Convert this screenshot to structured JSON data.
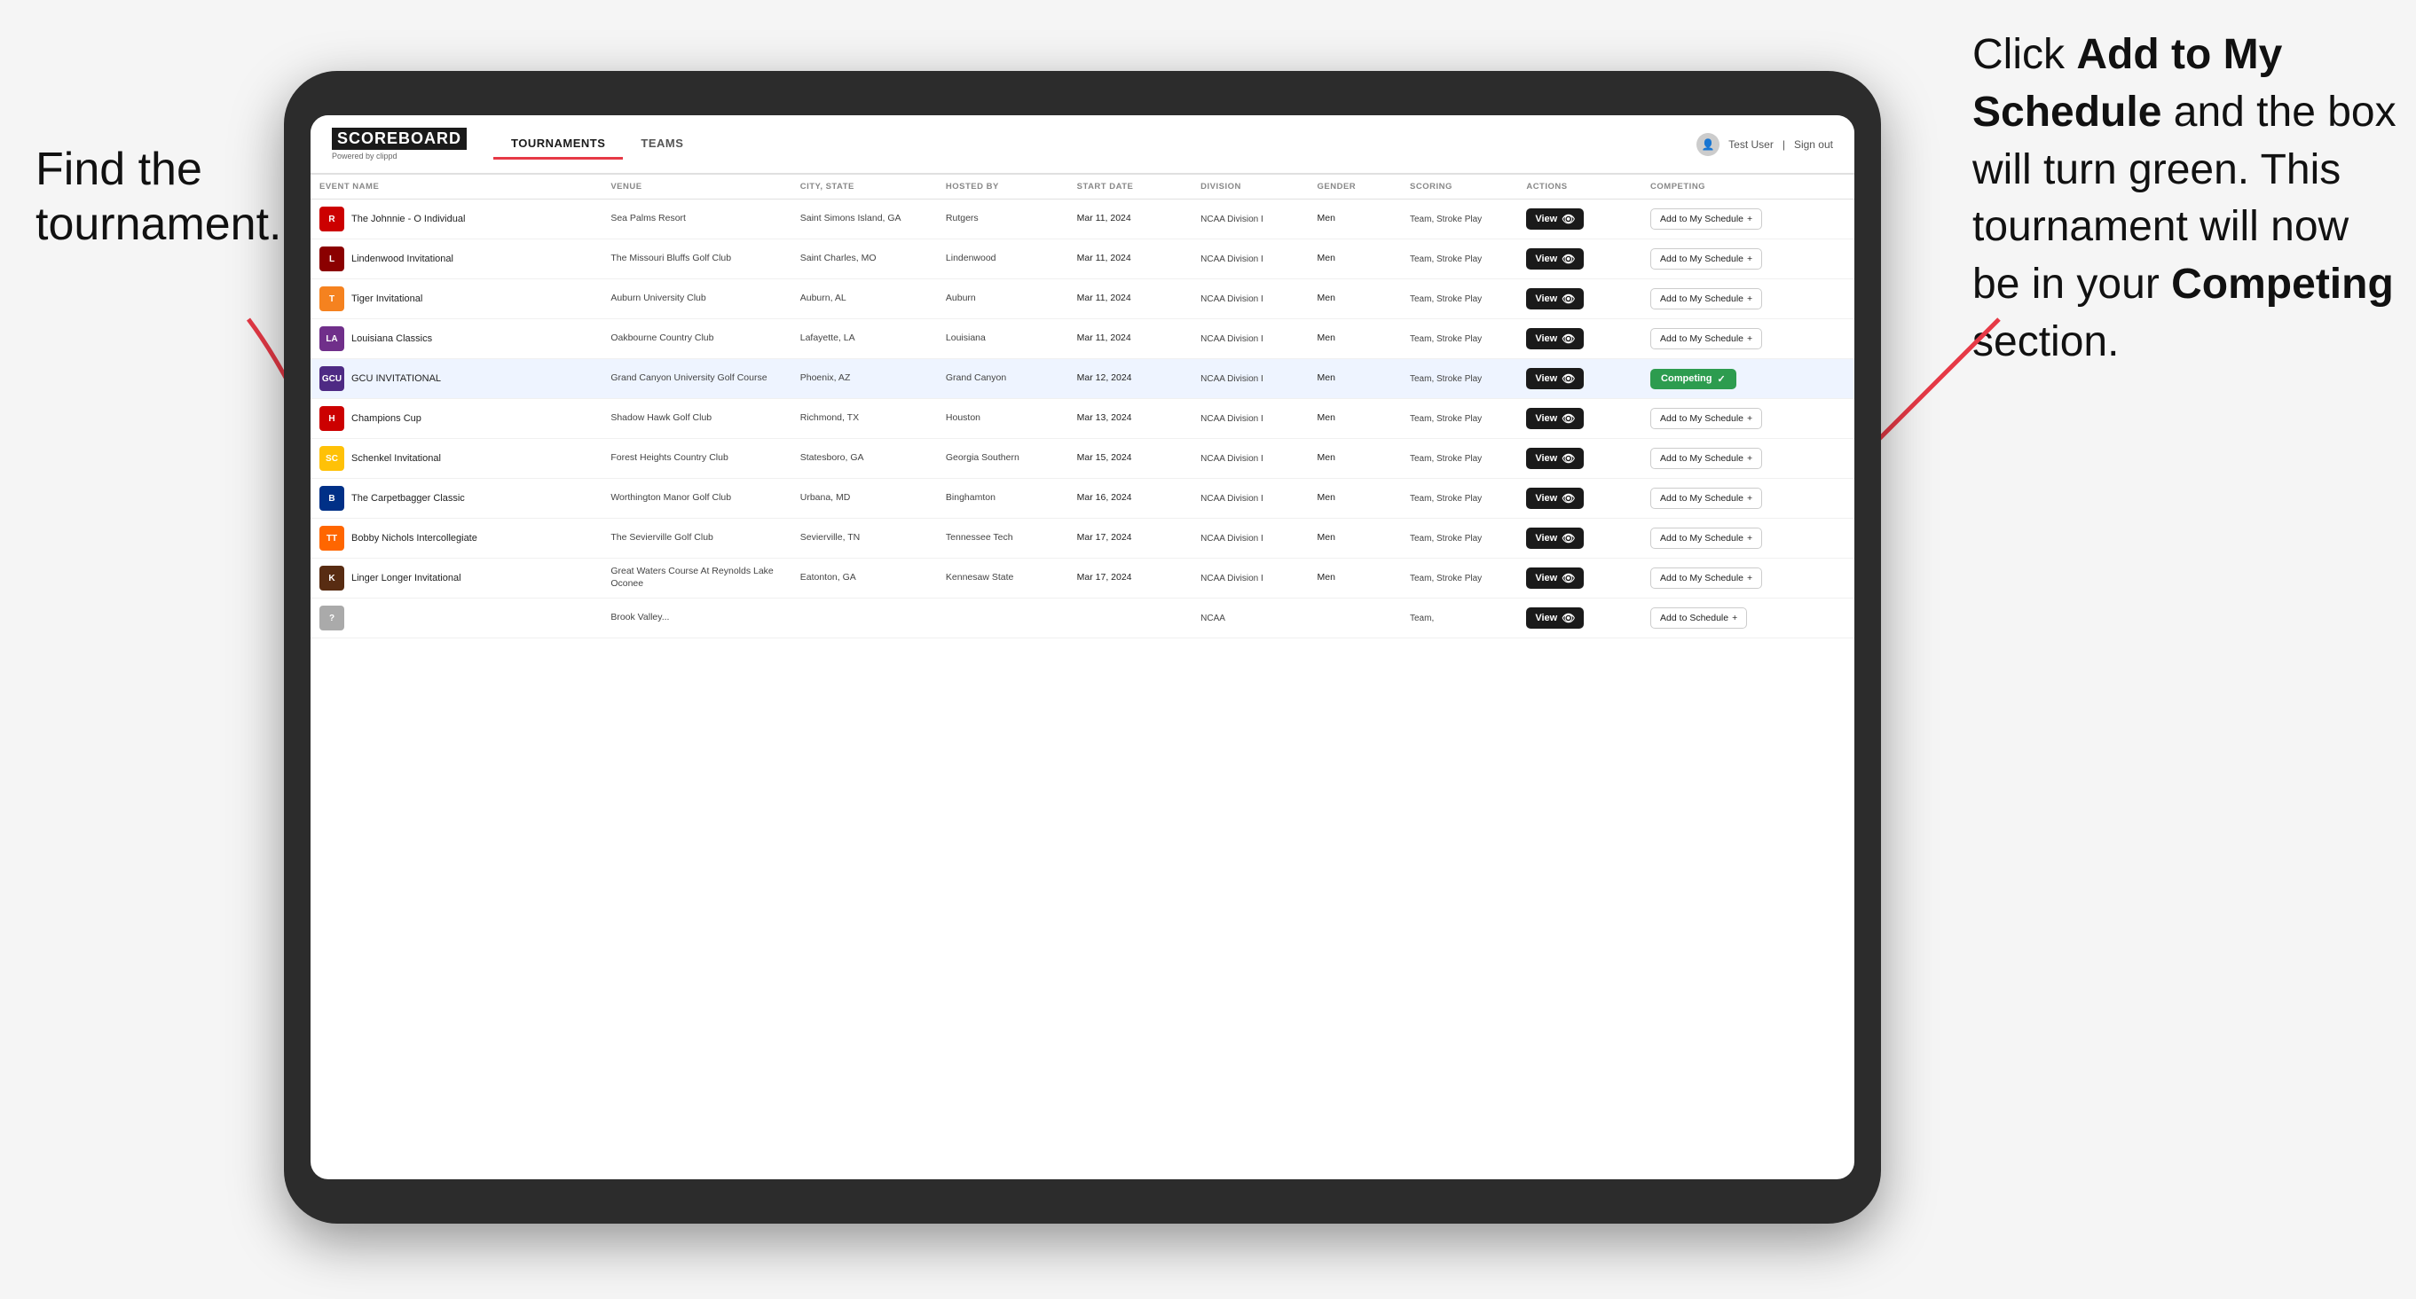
{
  "annotations": {
    "left_title": "Find the tournament.",
    "right_title_part1": "Click ",
    "right_bold1": "Add to My Schedule",
    "right_middle": " and the box will turn green. This tournament will now be in your ",
    "right_bold2": "Competing",
    "right_end": " section."
  },
  "header": {
    "logo": "SCOREBOARD",
    "logo_sub": "Powered by clippd",
    "nav": [
      "TOURNAMENTS",
      "TEAMS"
    ],
    "active_nav": "TOURNAMENTS",
    "user": "Test User",
    "sign_out": "Sign out"
  },
  "table": {
    "columns": [
      "EVENT NAME",
      "VENUE",
      "CITY, STATE",
      "HOSTED BY",
      "START DATE",
      "DIVISION",
      "GENDER",
      "SCORING",
      "ACTIONS",
      "COMPETING"
    ],
    "rows": [
      {
        "logo": "🔴",
        "logo_letter": "R",
        "event": "The Johnnie - O Individual",
        "venue": "Sea Palms Resort",
        "city": "Saint Simons Island, GA",
        "hosted": "Rutgers",
        "date": "Mar 11, 2024",
        "division": "NCAA Division I",
        "gender": "Men",
        "scoring": "Team, Stroke Play",
        "view_label": "View",
        "action_label": "Add to My Schedule",
        "status": "add"
      },
      {
        "logo": "🦁",
        "logo_letter": "L",
        "event": "Lindenwood Invitational",
        "venue": "The Missouri Bluffs Golf Club",
        "city": "Saint Charles, MO",
        "hosted": "Lindenwood",
        "date": "Mar 11, 2024",
        "division": "NCAA Division I",
        "gender": "Men",
        "scoring": "Team, Stroke Play",
        "view_label": "View",
        "action_label": "Add to My Schedule",
        "status": "add"
      },
      {
        "logo": "🐯",
        "logo_letter": "T",
        "event": "Tiger Invitational",
        "venue": "Auburn University Club",
        "city": "Auburn, AL",
        "hosted": "Auburn",
        "date": "Mar 11, 2024",
        "division": "NCAA Division I",
        "gender": "Men",
        "scoring": "Team, Stroke Play",
        "view_label": "View",
        "action_label": "Add to My Schedule",
        "status": "add"
      },
      {
        "logo": "🔷",
        "logo_letter": "LA",
        "event": "Louisiana Classics",
        "venue": "Oakbourne Country Club",
        "city": "Lafayette, LA",
        "hosted": "Louisiana",
        "date": "Mar 11, 2024",
        "division": "NCAA Division I",
        "gender": "Men",
        "scoring": "Team, Stroke Play",
        "view_label": "View",
        "action_label": "Add to My Schedule",
        "status": "add"
      },
      {
        "logo": "⛰️",
        "logo_letter": "GCU",
        "event": "GCU INVITATIONAL",
        "venue": "Grand Canyon University Golf Course",
        "city": "Phoenix, AZ",
        "hosted": "Grand Canyon",
        "date": "Mar 12, 2024",
        "division": "NCAA Division I",
        "gender": "Men",
        "scoring": "Team, Stroke Play",
        "view_label": "View",
        "action_label": "Competing",
        "status": "competing",
        "highlighted": true
      },
      {
        "logo": "🔴",
        "logo_letter": "H",
        "event": "Champions Cup",
        "venue": "Shadow Hawk Golf Club",
        "city": "Richmond, TX",
        "hosted": "Houston",
        "date": "Mar 13, 2024",
        "division": "NCAA Division I",
        "gender": "Men",
        "scoring": "Team, Stroke Play",
        "view_label": "View",
        "action_label": "Add to My Schedule",
        "status": "add"
      },
      {
        "logo": "🟡",
        "logo_letter": "SC",
        "event": "Schenkel Invitational",
        "venue": "Forest Heights Country Club",
        "city": "Statesboro, GA",
        "hosted": "Georgia Southern",
        "date": "Mar 15, 2024",
        "division": "NCAA Division I",
        "gender": "Men",
        "scoring": "Team, Stroke Play",
        "view_label": "View",
        "action_label": "Add to My Schedule",
        "status": "add"
      },
      {
        "logo": "🔵",
        "logo_letter": "B",
        "event": "The Carpetbagger Classic",
        "venue": "Worthington Manor Golf Club",
        "city": "Urbana, MD",
        "hosted": "Binghamton",
        "date": "Mar 16, 2024",
        "division": "NCAA Division I",
        "gender": "Men",
        "scoring": "Team, Stroke Play",
        "view_label": "View",
        "action_label": "Add to My Schedule",
        "status": "add"
      },
      {
        "logo": "🟠",
        "logo_letter": "TT",
        "event": "Bobby Nichols Intercollegiate",
        "venue": "The Sevierville Golf Club",
        "city": "Sevierville, TN",
        "hosted": "Tennessee Tech",
        "date": "Mar 17, 2024",
        "division": "NCAA Division I",
        "gender": "Men",
        "scoring": "Team, Stroke Play",
        "view_label": "View",
        "action_label": "Add to My Schedule",
        "status": "add"
      },
      {
        "logo": "🟤",
        "logo_letter": "K",
        "event": "Linger Longer Invitational",
        "venue": "Great Waters Course At Reynolds Lake Oconee",
        "city": "Eatonton, GA",
        "hosted": "Kennesaw State",
        "date": "Mar 17, 2024",
        "division": "NCAA Division I",
        "gender": "Men",
        "scoring": "Team, Stroke Play",
        "view_label": "View",
        "action_label": "Add to My Schedule",
        "status": "add"
      },
      {
        "logo": "⚪",
        "logo_letter": "?",
        "event": "",
        "venue": "Brook Valley...",
        "city": "",
        "hosted": "",
        "date": "",
        "division": "NCAA",
        "gender": "",
        "scoring": "Team,",
        "view_label": "View",
        "action_label": "Add to Schedule",
        "status": "add"
      }
    ]
  }
}
